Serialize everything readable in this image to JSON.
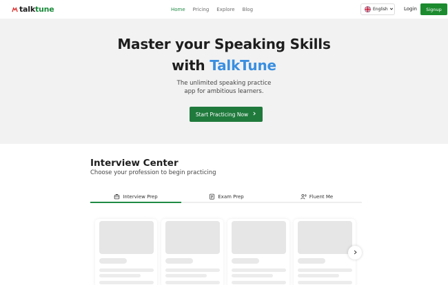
{
  "header": {
    "logo": {
      "prefix": "talk",
      "suffix": "tune"
    },
    "nav": [
      {
        "label": "Home",
        "active": true
      },
      {
        "label": "Pricing",
        "active": false
      },
      {
        "label": "Explore",
        "active": false
      },
      {
        "label": "Blog",
        "active": false
      }
    ],
    "language": {
      "label": "English",
      "icon": "uk-flag-icon"
    },
    "login_label": "Login",
    "signup_label": "Signup"
  },
  "hero": {
    "title_line1": "Master your Speaking Skills",
    "title_line2_prefix": "with",
    "title_line2_brand": "TalkTune",
    "subtitle_line1": "The unlimited speaking practice",
    "subtitle_line2": "app for ambitious learners.",
    "cta_label": "Start Practicing Now",
    "cta_icon": "chevron-right-icon"
  },
  "interview_center": {
    "title": "Interview Center",
    "subtitle": "Choose your profession to begin practicing",
    "tabs": [
      {
        "label": "Interview Prep",
        "icon": "briefcase-icon",
        "active": true
      },
      {
        "label": "Exam Prep",
        "icon": "clipboard-icon",
        "active": false
      },
      {
        "label": "Fluent Me",
        "icon": "speaking-person-icon",
        "active": false
      }
    ],
    "next_icon": "chevron-right-icon"
  },
  "colors": {
    "brand_green": "#1f8a44",
    "brand_blue": "#3a8fe0",
    "hero_bg": "#f2f2f2"
  }
}
